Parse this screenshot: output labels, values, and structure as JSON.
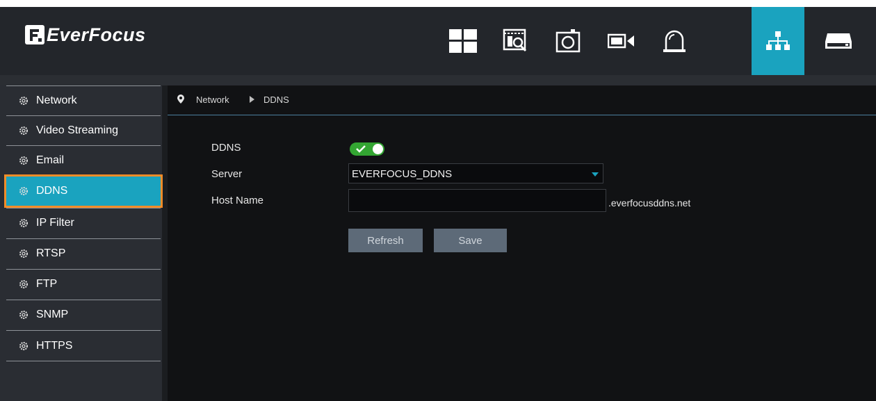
{
  "brand": {
    "name": "EverFocus"
  },
  "toolbar": {
    "icons": [
      "layout-grid-icon",
      "playback-search-icon",
      "snapshot-icon",
      "record-camera-icon",
      "alarm-bell-icon",
      "network-icon",
      "storage-drive-icon"
    ],
    "active_icon": "network-icon"
  },
  "sidebar": {
    "items": [
      {
        "label": "Network"
      },
      {
        "label": "Video Streaming"
      },
      {
        "label": "Email"
      },
      {
        "label": "DDNS"
      },
      {
        "label": "IP Filter"
      },
      {
        "label": "RTSP"
      },
      {
        "label": "FTP"
      },
      {
        "label": "SNMP"
      },
      {
        "label": "HTTPS"
      }
    ],
    "active": "DDNS"
  },
  "breadcrumb": {
    "parent": "Network",
    "current": "DDNS"
  },
  "form": {
    "ddns_label": "DDNS",
    "ddns_enabled": true,
    "server_label": "Server",
    "server_value": "EVERFOCUS_DDNS",
    "host_label": "Host Name",
    "host_value": "",
    "host_suffix": ".everfocusddns.net"
  },
  "buttons": {
    "refresh": "Refresh",
    "save": "Save"
  },
  "colors": {
    "accent": "#1aa3bf",
    "highlight_outline": "#f28c28",
    "toggle_on": "#33a532",
    "button": "#5d6a78"
  }
}
